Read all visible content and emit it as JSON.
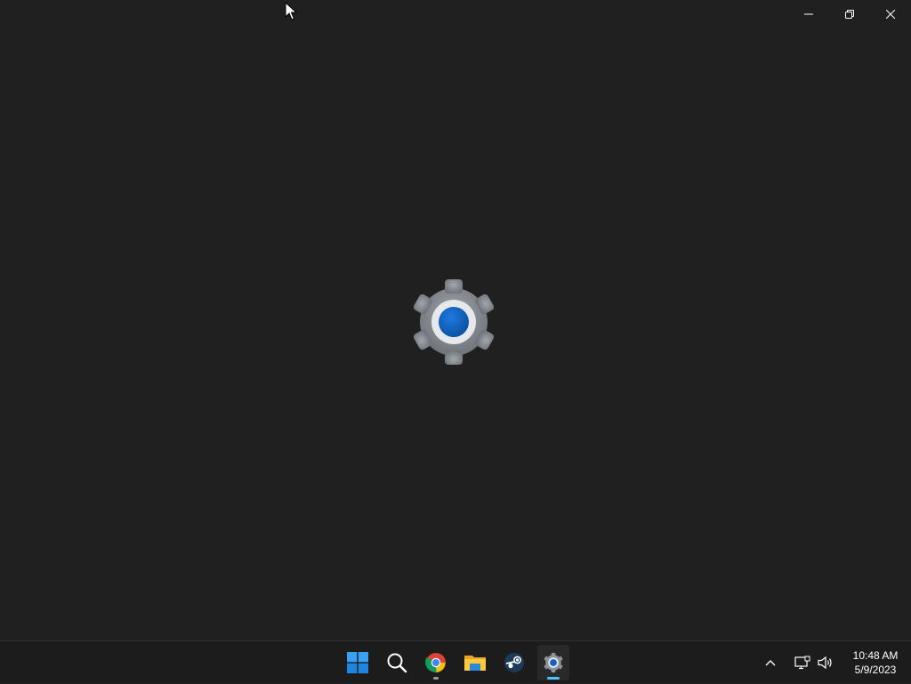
{
  "window": {
    "app_icon": "settings-gear-icon",
    "controls": {
      "minimize_icon": "minimize-icon",
      "restore_icon": "restore-icon",
      "close_icon": "close-icon"
    },
    "background_color": "#202020"
  },
  "taskbar": {
    "pinned": [
      {
        "name": "start",
        "icon": "windows-logo-icon",
        "running": false
      },
      {
        "name": "search",
        "icon": "search-icon",
        "running": false
      },
      {
        "name": "chrome",
        "icon": "chrome-icon",
        "running": true
      },
      {
        "name": "file-explorer",
        "icon": "folder-icon",
        "running": false
      },
      {
        "name": "steam",
        "icon": "steam-icon",
        "running": false
      },
      {
        "name": "settings",
        "icon": "settings-gear-icon",
        "running": true,
        "active": true
      }
    ],
    "tray": {
      "chevron_icon": "chevron-up-icon",
      "network_icon": "network-icon",
      "volume_icon": "volume-icon",
      "time": "10:48 AM",
      "date": "5/9/2023"
    },
    "accent_color": "#4cc2ff"
  },
  "colors": {
    "gear_gray": "#8e9299",
    "gear_center": "#0f62c0",
    "taskbar_bg": "#1c1c1c"
  }
}
